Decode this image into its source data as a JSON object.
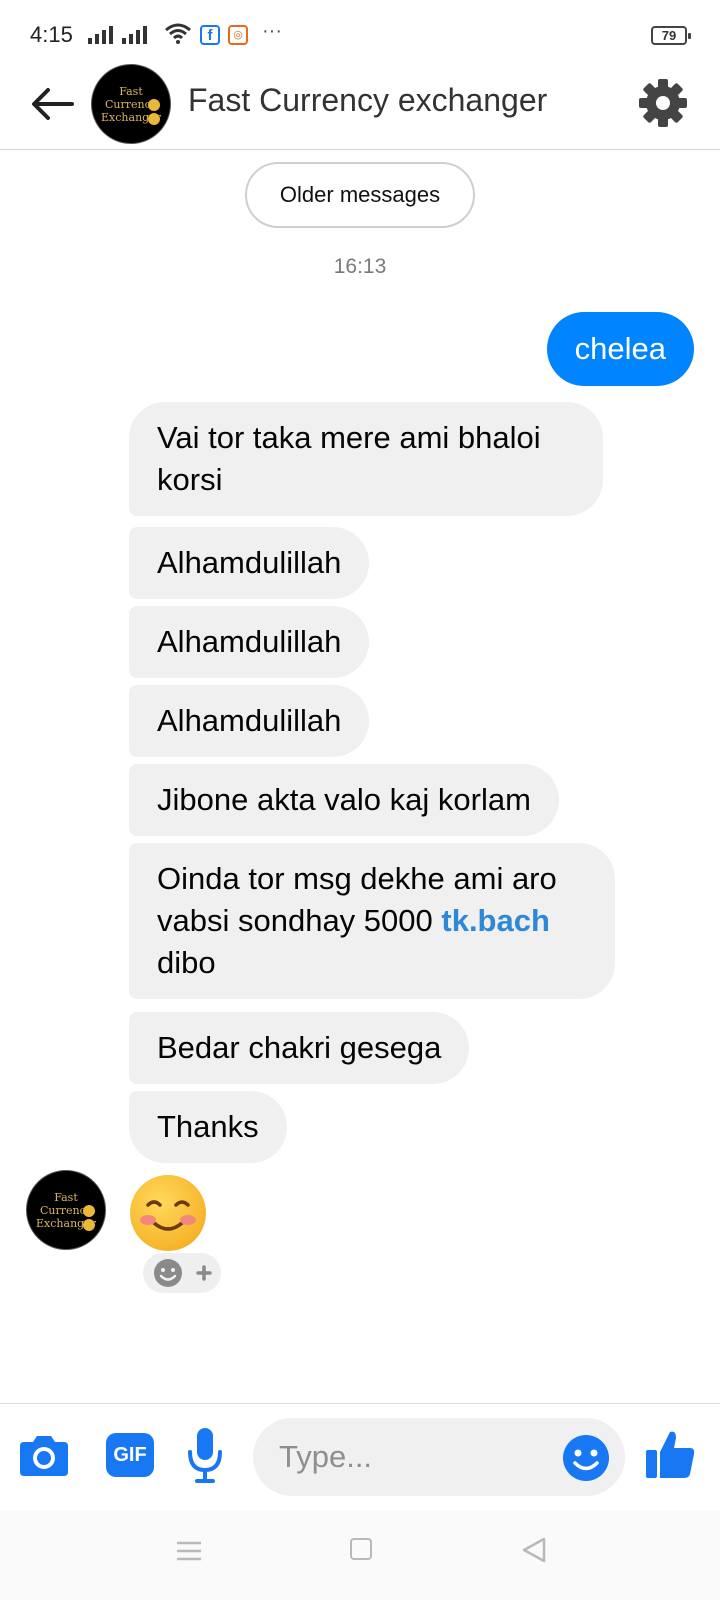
{
  "status_bar": {
    "time": "4:15",
    "battery": "79",
    "more": "···",
    "notif_fb": "f"
  },
  "header": {
    "title": "Fast Currency exchanger",
    "avatar_logo_lines": [
      "Fast",
      "Currency",
      "Exchanger"
    ]
  },
  "thread": {
    "older_messages_label": "Older messages",
    "timestamp": "16:13",
    "outgoing": [
      {
        "text": "chelea"
      }
    ],
    "incoming": [
      {
        "text": "Vai tor taka mere ami bhaloi korsi"
      },
      {
        "text": "Alhamdulillah"
      },
      {
        "text": "Alhamdulillah"
      },
      {
        "text": "Alhamdulillah"
      },
      {
        "text": "Jibone akta valo kaj korlam"
      },
      {
        "text_before": "Oinda tor msg dekhe ami aro vabsi sondhay 5000 ",
        "link": "tk.bach",
        "text_after": " dibo"
      },
      {
        "text": "Bedar chakri gesega"
      },
      {
        "text": "Thanks"
      }
    ],
    "last_message_emoji": "smiling-face-with-blush"
  },
  "composer": {
    "placeholder": "Type...",
    "gif_label": "GIF"
  },
  "colors": {
    "accent": "#0084ff",
    "messenger_blue": "#1877f2",
    "incoming_bubble": "#f0f0f0",
    "link": "#2d88d6"
  }
}
